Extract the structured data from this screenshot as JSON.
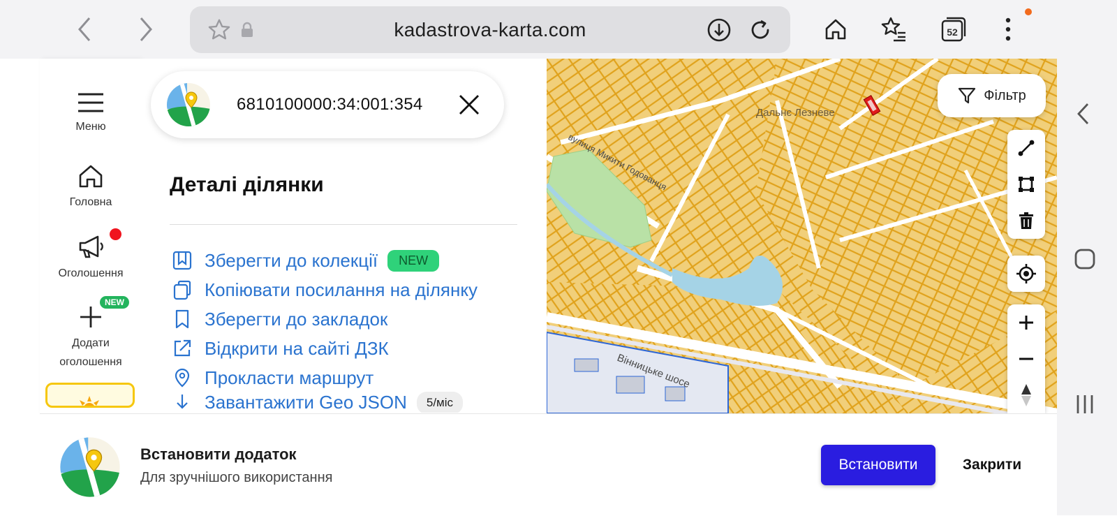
{
  "browser": {
    "url": "kadastrova-karta.com",
    "tab_count": "52",
    "accent_dot_color": "#f26b1d"
  },
  "sidebar": {
    "items": [
      {
        "label": "Меню",
        "icon": "menu-icon"
      },
      {
        "label": "Головна",
        "icon": "home-icon"
      },
      {
        "label": "Оголошення",
        "icon": "megaphone-icon",
        "has_red_dot": true
      },
      {
        "label": "Додати оголошення",
        "icon": "plus-icon",
        "badge": "NEW"
      }
    ]
  },
  "search": {
    "value": "6810100000:34:001:354"
  },
  "details": {
    "title": "Деталі ділянки",
    "actions": [
      {
        "label": "Зберегти до колекції",
        "icon": "collection-icon",
        "badge": "NEW"
      },
      {
        "label": "Копіювати посилання на ділянку",
        "icon": "copy-icon"
      },
      {
        "label": "Зберегти до закладок",
        "icon": "bookmark-icon"
      },
      {
        "label": "Відкрити на сайті ДЗК",
        "icon": "external-link-icon"
      },
      {
        "label": "Прокласти маршрут",
        "icon": "location-pin-icon"
      },
      {
        "label": "Завантажити Geo JSON",
        "icon": "download-icon",
        "quota": "5/міс"
      }
    ]
  },
  "map": {
    "filter_label": "Фільтр",
    "labels": [
      "Дальнє Лезневе",
      "вулиця Микити Годованця",
      "Вінницьке шосе"
    ],
    "parcel_color": "#f1cf7a",
    "parcel_stroke": "#e0a21c",
    "selected_parcel_color": "#e01b1b",
    "water_color": "#a5d3e6",
    "park_color": "#b9e1a6"
  },
  "banner": {
    "title": "Встановити додаток",
    "subtitle": "Для зручнішого використання",
    "install_label": "Встановити",
    "close_label": "Закрити",
    "install_color": "#2a1de0"
  }
}
